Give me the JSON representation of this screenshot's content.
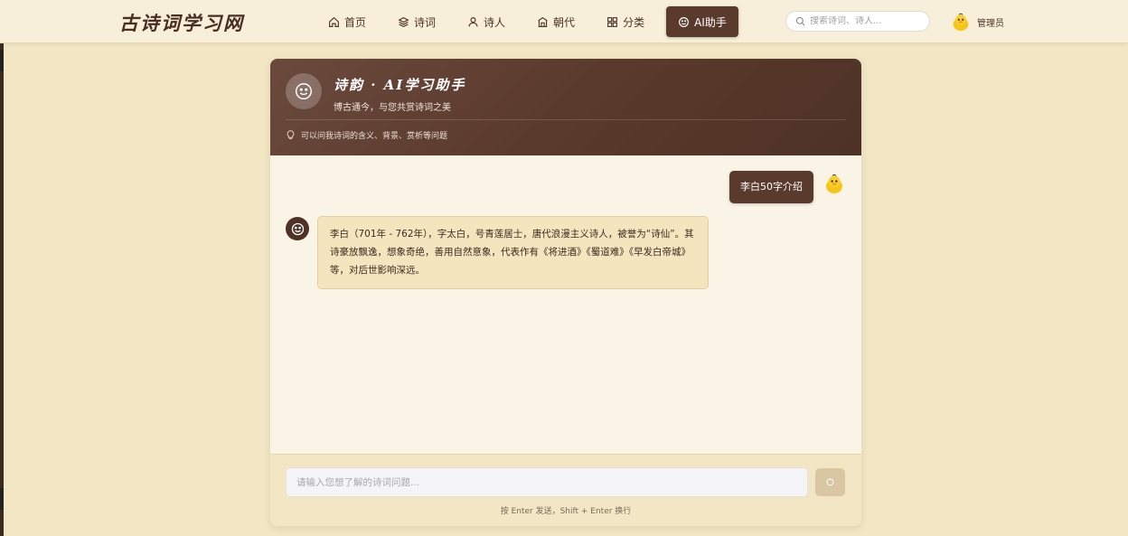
{
  "site": {
    "brand": "古诗词学习网"
  },
  "nav": {
    "items": [
      {
        "label": "首页",
        "icon": "home-icon"
      },
      {
        "label": "诗词",
        "icon": "layers-icon"
      },
      {
        "label": "诗人",
        "icon": "user-icon"
      },
      {
        "label": "朝代",
        "icon": "temple-icon"
      },
      {
        "label": "分类",
        "icon": "grid-icon"
      },
      {
        "label": "AI助手",
        "icon": "smile-icon",
        "active": true
      }
    ]
  },
  "search": {
    "placeholder": "搜索诗词、诗人..."
  },
  "user": {
    "name": "管理员",
    "avatar": "duck-avatar"
  },
  "chat": {
    "header": {
      "title": "诗韵 · AI学习助手",
      "subtitle": "博古通今，与您共赏诗词之美",
      "hint": "可以问我诗词的含义、背景、赏析等问题"
    },
    "messages": [
      {
        "role": "user",
        "text": "李白50字介绍"
      },
      {
        "role": "assistant",
        "text": "李白（701年 - 762年），字太白，号青莲居士，唐代浪漫主义诗人，被誉为“诗仙”。其诗豪放飘逸，想象奇绝，善用自然意象，代表作有《将进酒》《蜀道难》《早发白帝城》等，对后世影响深远。"
      }
    ],
    "input": {
      "placeholder": "请输入您想了解的诗词问题...",
      "value": ""
    },
    "input_hint": "按 Enter 发送，Shift + Enter 换行"
  },
  "colors": {
    "background": "#f2e6c5",
    "accent": "#5a3a2c",
    "bot_bubble": "#f3e5be"
  }
}
